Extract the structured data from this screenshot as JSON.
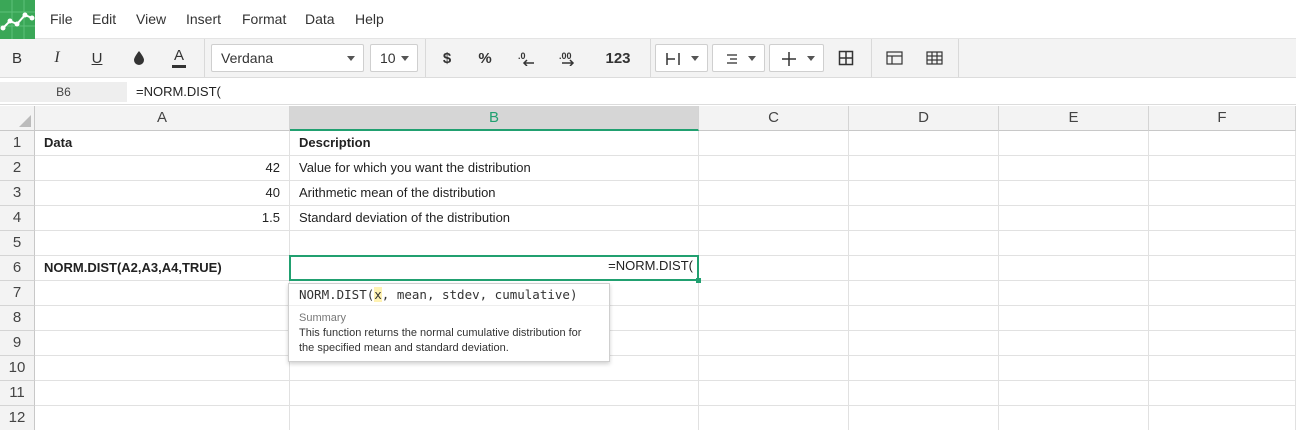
{
  "menu": {
    "items": [
      "File",
      "Edit",
      "View",
      "Insert",
      "Format",
      "Data",
      "Help"
    ]
  },
  "toolbar": {
    "bold": "B",
    "italic": "I",
    "underline": "U",
    "font_name": "Verdana",
    "font_size": "10",
    "currency": "$",
    "percent": "%",
    "number_format": "123",
    "decrease_decimal": ".0",
    "increase_decimal": ".00"
  },
  "formula_bar": {
    "cell_ref": "B6",
    "formula": "=NORM.DIST("
  },
  "columns": [
    "A",
    "B",
    "C",
    "D",
    "E",
    "F"
  ],
  "rows": [
    "1",
    "2",
    "3",
    "4",
    "5",
    "6",
    "7",
    "8",
    "9",
    "10",
    "11",
    "12"
  ],
  "cells": {
    "A1": "Data",
    "B1": "Description",
    "A2": "42",
    "B2": "Value for which you want the distribution",
    "A3": "40",
    "B3": "Arithmetic mean of the distribution",
    "A4": "1.5",
    "B4": "Standard deviation of the distribution",
    "A6": "NORM.DIST(A2,A3,A4,TRUE)",
    "B6": "=NORM.DIST("
  },
  "tooltip": {
    "sig_start": "NORM.DIST(",
    "sig_current": "x",
    "sig_rest": ", mean, stdev, cumulative)",
    "summary_label": "Summary",
    "summary_text": "This function returns the normal cumulative distribution for the specified mean and standard deviation."
  },
  "colors": {
    "accent": "#21a070",
    "logo": "#3aa757",
    "tooltip_highlight": "#fff2b3"
  }
}
